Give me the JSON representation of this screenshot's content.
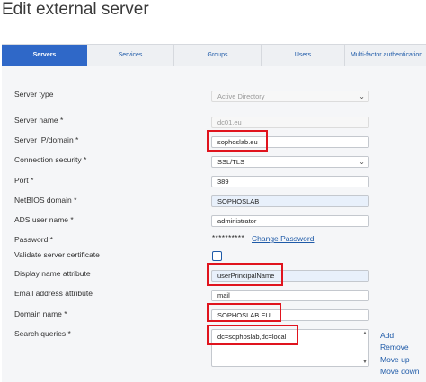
{
  "page": {
    "title": "Edit external server"
  },
  "tabs": [
    {
      "label": "Servers",
      "active": true
    },
    {
      "label": "Services",
      "active": false
    },
    {
      "label": "Groups",
      "active": false
    },
    {
      "label": "Users",
      "active": false
    },
    {
      "label": "Multi-factor authentication",
      "active": false
    }
  ],
  "form": {
    "server_type": {
      "label": "Server type",
      "value": "Active Directory"
    },
    "server_name": {
      "label": "Server name *",
      "value": "dc01.eu"
    },
    "server_ip": {
      "label": "Server IP/domain *",
      "value": "sophoslab.eu"
    },
    "connection_security": {
      "label": "Connection security *",
      "value": "SSL/TLS"
    },
    "port": {
      "label": "Port *",
      "value": "389"
    },
    "netbios_domain": {
      "label": "NetBIOS domain *",
      "value": "SOPHOSLAB"
    },
    "ads_user_name": {
      "label": "ADS user name *",
      "value": "administrator"
    },
    "password": {
      "label": "Password *",
      "masked": "**********",
      "change_link": "Change Password"
    },
    "validate_cert": {
      "label": "Validate server certificate",
      "checked": false
    },
    "display_name_attr": {
      "label": "Display name attribute",
      "value": "userPrincipalName"
    },
    "email_attr": {
      "label": "Email address attribute",
      "value": "mail"
    },
    "domain_name": {
      "label": "Domain name *",
      "value": "SOPHOSLAB.EU"
    },
    "search_queries": {
      "label": "Search queries *",
      "items": [
        "dc=sophoslab,dc=local"
      ]
    }
  },
  "query_actions": {
    "add": "Add",
    "remove": "Remove",
    "move_up": "Move up",
    "move_down": "Move down"
  },
  "colors": {
    "tab_active": "#2f68c8",
    "link": "#1e5aa8",
    "highlight_box": "#e0141e"
  },
  "icons": {
    "select": "chevron-down-icon",
    "scroll_up": "triangle-up-icon",
    "scroll_down": "triangle-down-icon"
  }
}
